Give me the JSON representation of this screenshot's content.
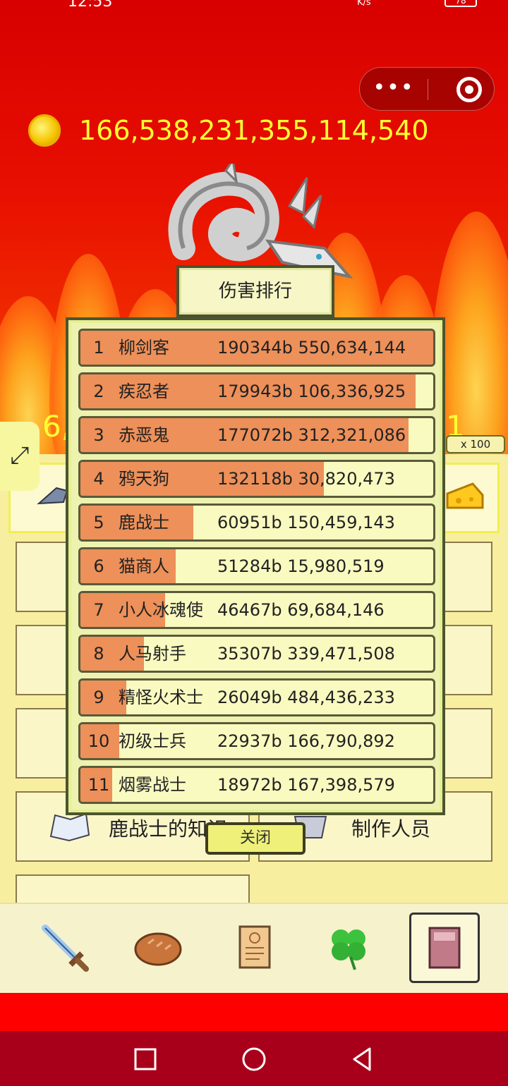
{
  "status_bar": {
    "time": "12:53",
    "net_unit": "K/s",
    "battery": "78"
  },
  "gold_amount": "166,538,231,355,114,540",
  "background_numbers": {
    "left": "6,",
    "right": "1"
  },
  "multiplier_badge": "x 100",
  "menu_items": {
    "deer_knowledge": "鹿战士的知识",
    "credits": "制作人员"
  },
  "ranking": {
    "title": "伤害排行",
    "close_label": "关闭",
    "rows": [
      {
        "rank": "1",
        "name": "柳剑客",
        "score": "190344b 550,634,144",
        "bar_fraction": 1.0
      },
      {
        "rank": "2",
        "name": "疾忍者",
        "score": "179943b 106,336,925",
        "bar_fraction": 0.95
      },
      {
        "rank": "3",
        "name": "赤恶鬼",
        "score": "177072b 312,321,086",
        "bar_fraction": 0.93
      },
      {
        "rank": "4",
        "name": "鸦天狗",
        "score": "132118b 30,820,473",
        "bar_fraction": 0.69
      },
      {
        "rank": "5",
        "name": "鹿战士",
        "score": "60951b 150,459,143",
        "bar_fraction": 0.32
      },
      {
        "rank": "6",
        "name": "猫商人",
        "score": "51284b 15,980,519",
        "bar_fraction": 0.27
      },
      {
        "rank": "7",
        "name": "小人冰魂使",
        "score": "46467b 69,684,146",
        "bar_fraction": 0.24
      },
      {
        "rank": "8",
        "name": "人马射手",
        "score": "35307b 339,471,508",
        "bar_fraction": 0.18
      },
      {
        "rank": "9",
        "name": "精怪火术士",
        "score": "26049b 484,436,233",
        "bar_fraction": 0.13
      },
      {
        "rank": "10",
        "name": "初级士兵",
        "score": "22937b 166,790,892",
        "bar_fraction": 0.11
      },
      {
        "rank": "11",
        "name": "烟雾战士",
        "score": "18972b 167,398,579",
        "bar_fraction": 0.09
      }
    ]
  },
  "bottom_nav": [
    {
      "icon": "sword-icon"
    },
    {
      "icon": "bread-icon"
    },
    {
      "icon": "scroll-icon"
    },
    {
      "icon": "clover-icon"
    },
    {
      "icon": "book-icon",
      "active": true
    }
  ],
  "colors": {
    "bar_fill": "#ed9059",
    "row_bg": "#f9fac0",
    "gold_text": "#ffff33"
  }
}
